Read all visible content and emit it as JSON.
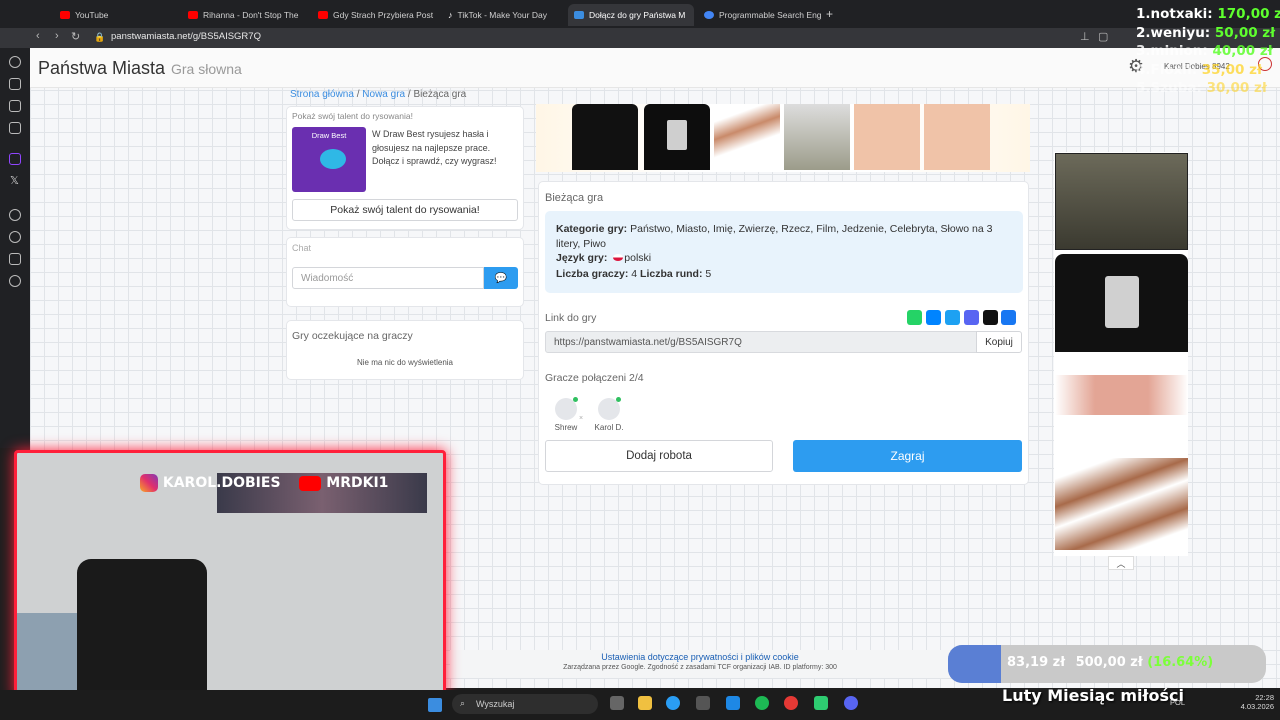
{
  "browser": {
    "tabs": [
      {
        "label": "YouTube",
        "color": "#ff0000"
      },
      {
        "label": "Rihanna - Don't Stop The",
        "color": "#ff0000"
      },
      {
        "label": "Gdy Strach Przybiera Post",
        "color": "#ff0000"
      },
      {
        "label": "TikTok - Make Your Day",
        "color": "#ffffff"
      },
      {
        "label": "Dołącz do gry Państwa M",
        "color": "#3b8de0",
        "active": true
      },
      {
        "label": "Programmable Search Eng",
        "color": "#4285f4"
      }
    ],
    "url": "panstwamiasta.net/g/BS5AISGR7Q"
  },
  "site": {
    "title": "Państwa Miasta",
    "subtitle": "Gra słowna",
    "user_label": "Karol Dobies 8942"
  },
  "breadcrumb": {
    "home": "Strona główna",
    "new_game": "Nowa gra",
    "current": "Bieżąca gra"
  },
  "promo": {
    "title": "Pokaż swój talent do rysowania!",
    "image_label": "Draw Best",
    "text": "W Draw Best rysujesz hasła i głosujesz na najlepsze prace. Dołącz i sprawdź, czy wygrasz!",
    "button": "Pokaż swój talent do rysowania!"
  },
  "chat": {
    "title": "Chat",
    "placeholder": "Wiadomość"
  },
  "waiting": {
    "title": "Gry oczekujące na graczy",
    "empty": "Nie ma nic do wyświetlenia"
  },
  "game": {
    "title": "Bieżąca gra",
    "categories_label": "Kategorie gry:",
    "categories": "Państwo, Miasto, Imię, Zwierzę, Rzecz, Film, Jedzenie, Celebryta, Słowo na 3 litery, Piwo",
    "language_label": "Język gry:",
    "language": "polski",
    "players_label": "Liczba graczy:",
    "players": "4",
    "rounds_label": "Liczba rund:",
    "rounds": "5",
    "link_label": "Link do gry",
    "link": "https://panstwamiasta.net/g/BS5AISGR7Q",
    "copy": "Kopiuj",
    "connected": "Gracze połączeni 2/4",
    "player_list": [
      "Shrew",
      "Karol D."
    ],
    "add_robot": "Dodaj robota",
    "play": "Zagraj"
  },
  "share_colors": [
    "#25d366",
    "#0084ff",
    "#1da1f2",
    "#5865f2",
    "#111111",
    "#1877f2"
  ],
  "leaderboard": [
    {
      "name": "1.notxaki:",
      "amount": "170,00 zł"
    },
    {
      "name": "2.weniyu:",
      "amount": "50,00 zł"
    },
    {
      "name": "3.minion:",
      "amount": "40,00 zł"
    },
    {
      "name": "4.Floxii:",
      "amount": "35,00 zł"
    },
    {
      "name": "5.Szuba:",
      "amount": "30,00 zł"
    }
  ],
  "stream": {
    "instagram": "KAROL.DOBIES",
    "youtube": "MRDKI1",
    "goal_current": "83,19 zł",
    "goal_target": "500,00 zł",
    "goal_percent": "(16.64%)",
    "goal_fraction": 0.1664,
    "banner": "Luty Miesiąc miłości"
  },
  "cookie": {
    "title": "Ustawienia dotyczące prywatności i plików cookie",
    "text": "Zarządzana przez Google. Zgodność z zasadami TCF organizacji IAB. ID platformy: 300"
  },
  "taskbar": {
    "search": "Wyszukaj",
    "lang": "POL",
    "time": "22:28",
    "date": "4.03.2026"
  }
}
